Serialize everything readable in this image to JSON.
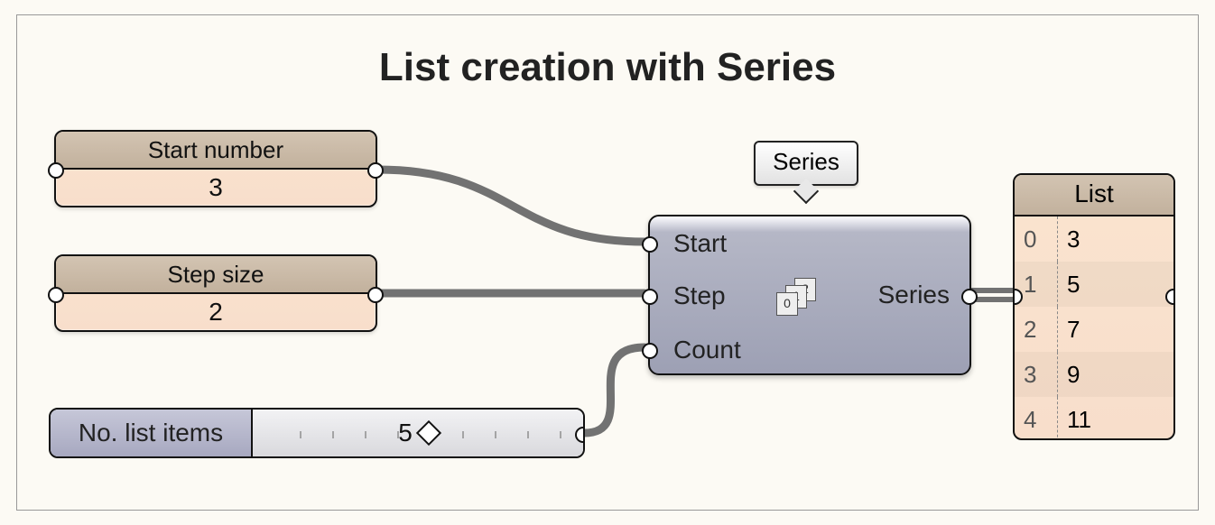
{
  "title": "List creation with Series",
  "panels": {
    "start": {
      "label": "Start number",
      "value": "3"
    },
    "step": {
      "label": "Step size",
      "value": "2"
    }
  },
  "slider": {
    "label": "No. list items",
    "value": "5"
  },
  "series": {
    "tooltip": "Series",
    "inputs": {
      "start": "Start",
      "step": "Step",
      "count": "Count"
    },
    "output": "Series"
  },
  "list": {
    "header": "List",
    "rows": [
      {
        "idx": "0",
        "val": "3"
      },
      {
        "idx": "1",
        "val": "5"
      },
      {
        "idx": "2",
        "val": "7"
      },
      {
        "idx": "3",
        "val": "9"
      },
      {
        "idx": "4",
        "val": "11"
      }
    ]
  }
}
